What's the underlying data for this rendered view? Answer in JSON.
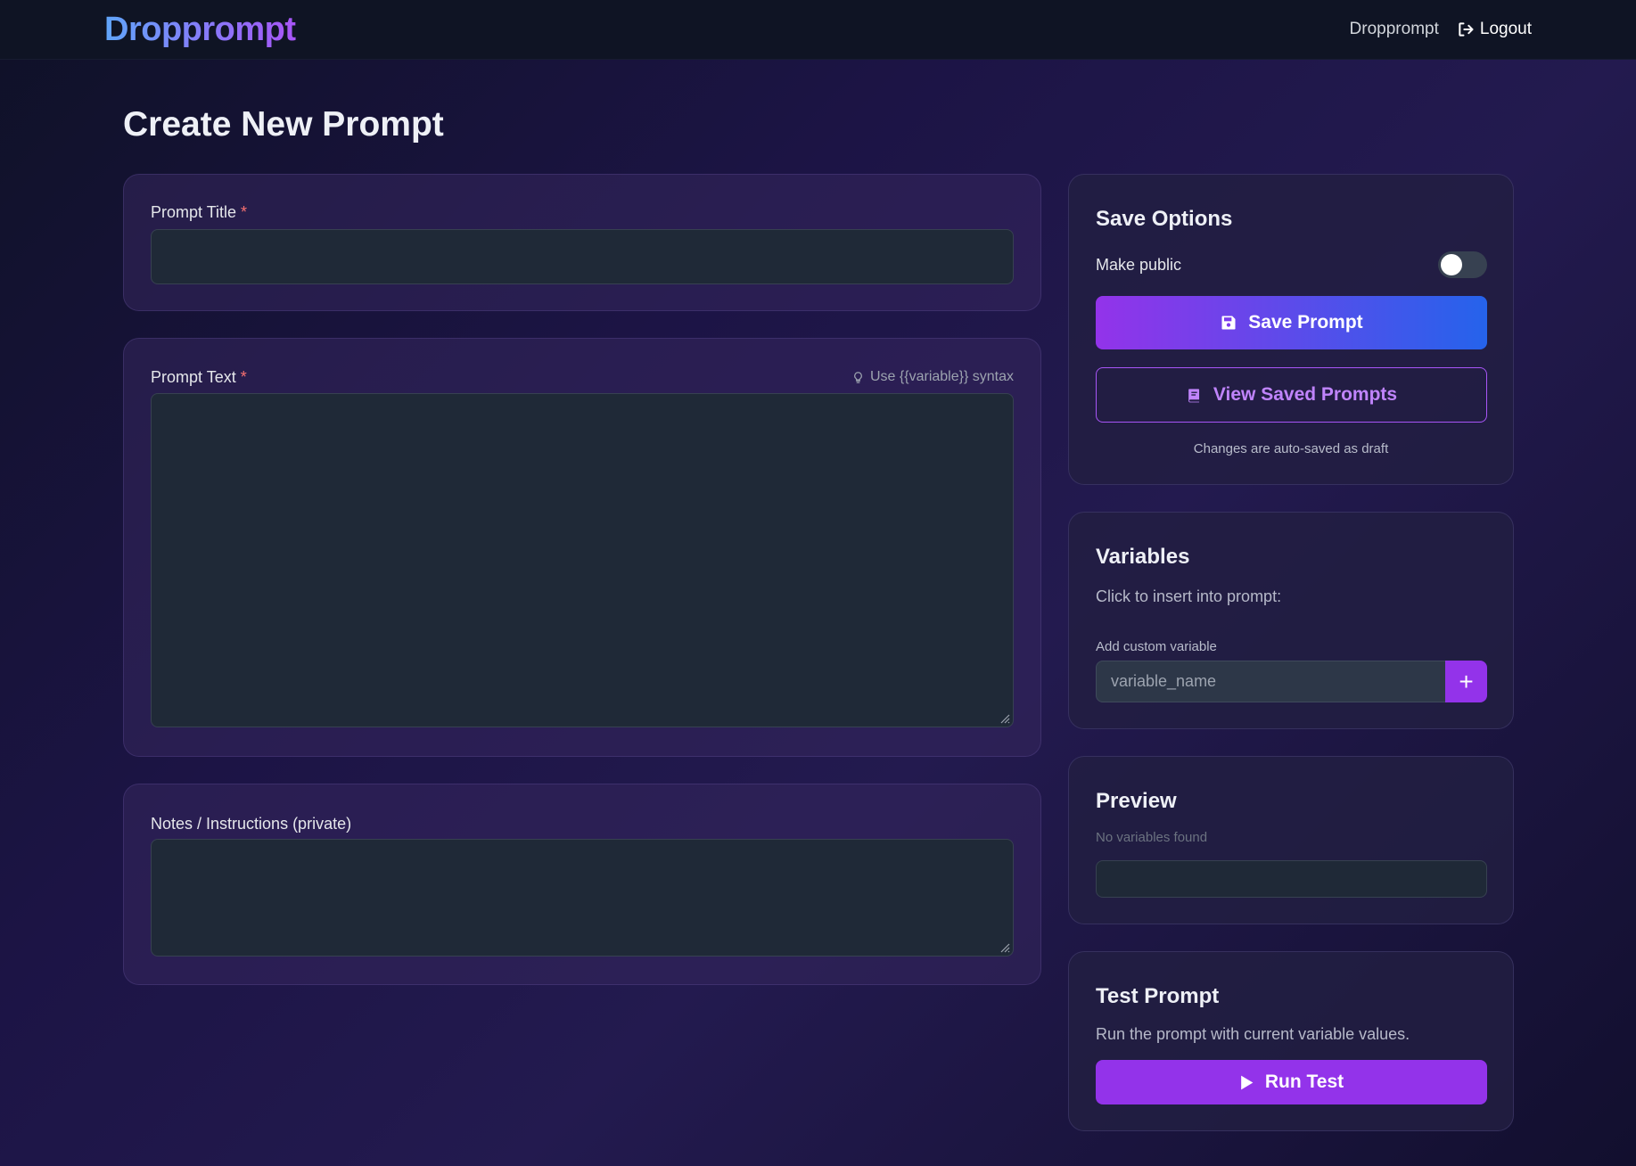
{
  "nav": {
    "brand": "Dropprompt",
    "link": "Dropprompt",
    "logout": "Logout"
  },
  "page": {
    "title": "Create New Prompt"
  },
  "form": {
    "title_label": "Prompt Title",
    "text_label": "Prompt Text",
    "required_mark": "*",
    "syntax_hint": "Use {{variable}} syntax",
    "notes_label": "Notes / Instructions (private)",
    "title_value": "",
    "text_value": "",
    "notes_value": ""
  },
  "save_options": {
    "heading": "Save Options",
    "make_public_label": "Make public",
    "make_public": false,
    "save_button": "Save Prompt",
    "view_button": "View Saved Prompts",
    "autosave_note": "Changes are auto-saved as draft"
  },
  "variables": {
    "heading": "Variables",
    "instruction": "Click to insert into prompt:",
    "custom_label": "Add custom variable",
    "custom_placeholder": "variable_name",
    "add_button": "+"
  },
  "preview": {
    "heading": "Preview",
    "empty_text": "No variables found"
  },
  "test": {
    "heading": "Test Prompt",
    "description": "Run the prompt with current variable values.",
    "run_button": "Run Test"
  },
  "colors": {
    "accent_purple": "#9333ea",
    "accent_blue": "#2563eb",
    "required_red": "#f87171"
  }
}
